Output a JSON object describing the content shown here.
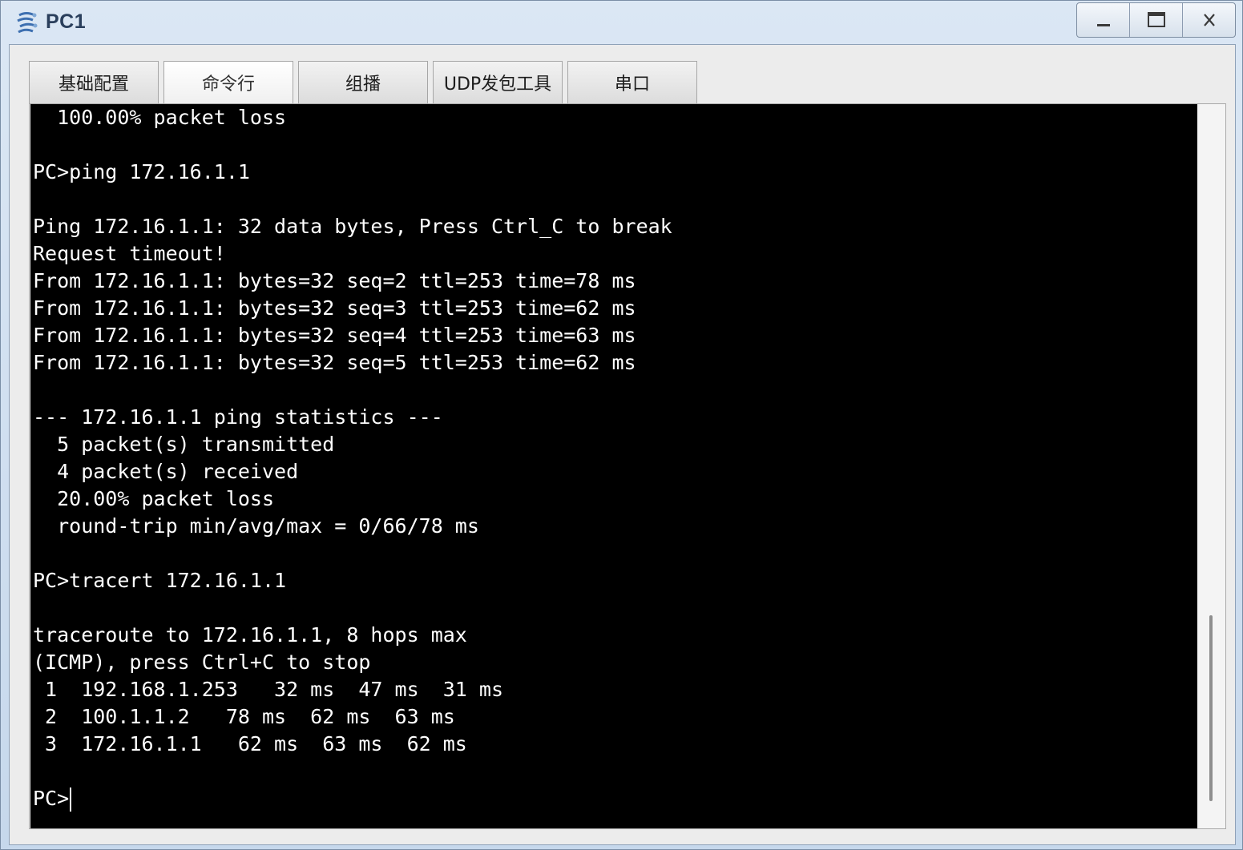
{
  "window": {
    "title": "PC1",
    "controls": {
      "minimize": "–",
      "maximize": "□",
      "close": "X"
    }
  },
  "tabs": [
    {
      "label": "基础配置",
      "active": false
    },
    {
      "label": "命令行",
      "active": true
    },
    {
      "label": "组播",
      "active": false
    },
    {
      "label": "UDP发包工具",
      "active": false
    },
    {
      "label": "串口",
      "active": false
    }
  ],
  "terminal": {
    "lines": [
      "  100.00% packet loss",
      "",
      "PC>ping 172.16.1.1",
      "",
      "Ping 172.16.1.1: 32 data bytes, Press Ctrl_C to break",
      "Request timeout!",
      "From 172.16.1.1: bytes=32 seq=2 ttl=253 time=78 ms",
      "From 172.16.1.1: bytes=32 seq=3 ttl=253 time=62 ms",
      "From 172.16.1.1: bytes=32 seq=4 ttl=253 time=63 ms",
      "From 172.16.1.1: bytes=32 seq=5 ttl=253 time=62 ms",
      "",
      "--- 172.16.1.1 ping statistics ---",
      "  5 packet(s) transmitted",
      "  4 packet(s) received",
      "  20.00% packet loss",
      "  round-trip min/avg/max = 0/66/78 ms",
      "",
      "PC>tracert 172.16.1.1",
      "",
      "traceroute to 172.16.1.1, 8 hops max",
      "(ICMP), press Ctrl+C to stop",
      " 1  192.168.1.253   32 ms  47 ms  31 ms",
      " 2  100.1.1.2   78 ms  62 ms  63 ms",
      " 3  172.16.1.1   62 ms  63 ms  62 ms",
      ""
    ],
    "prompt": "PC>",
    "colors": {
      "background": "#000000",
      "foreground": "#ffffff"
    }
  }
}
